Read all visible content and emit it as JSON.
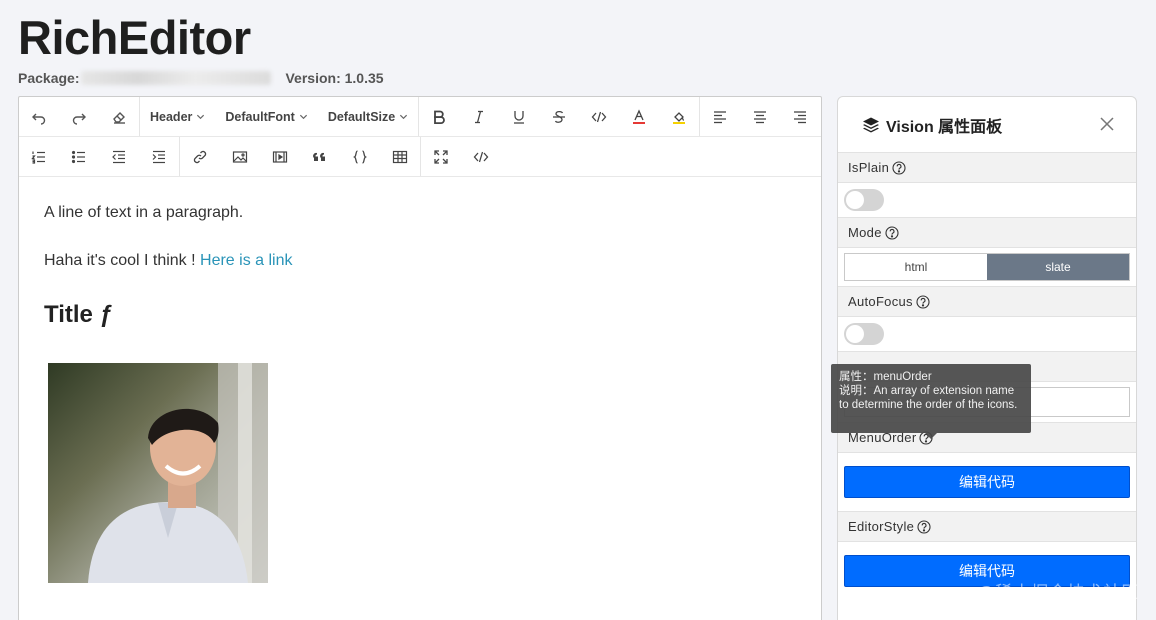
{
  "app": {
    "title": "RichEditor",
    "package_label": "Package:",
    "version_label": "Version: 1.0.35"
  },
  "toolbar": {
    "row1": {
      "history": [
        "undo-icon",
        "redo-icon",
        "eraser-icon"
      ],
      "header_select": "Header",
      "font_select": "DefaultFont",
      "size_select": "DefaultSize",
      "format": [
        "bold-icon",
        "italic-icon",
        "underline-icon",
        "strikethrough-icon",
        "code-icon",
        "font-color-icon",
        "highlight-icon"
      ],
      "align": [
        "align-left-icon",
        "align-center-icon",
        "align-right-icon"
      ]
    },
    "row2": {
      "lists": [
        "ordered-list-icon",
        "bulleted-list-icon",
        "outdent-icon",
        "indent-icon"
      ],
      "insert": [
        "link-icon",
        "image-icon",
        "video-icon",
        "quote-icon",
        "code-block-icon",
        "table-icon"
      ],
      "view": [
        "fullscreen-icon",
        "source-code-icon"
      ]
    }
  },
  "content": {
    "paragraph1": "A line of text in a paragraph.",
    "paragraph2_text": "Haha it's cool I think ! ",
    "paragraph2_link": "Here is a link",
    "heading": "Title ƒ"
  },
  "panel": {
    "title": "Vision 属性面板",
    "props": {
      "isplain": "IsPlain",
      "mode": "Mode",
      "mode_options": [
        "html",
        "slate"
      ],
      "mode_selected": "slate",
      "autofocus": "AutoFocus",
      "menuorder": "MenuOrder",
      "menuorder_button": "编辑代码",
      "editorstyle": "EditorStyle",
      "editorstyle_button": "编辑代码"
    }
  },
  "tooltip": {
    "line1": "属性：menuOrder",
    "line2": "说明：An array of extension name to determine the order of the icons."
  },
  "watermark": "@稀土掘金技术社区",
  "colors": {
    "primary": "#006cff",
    "segment_active": "#6b7888",
    "link": "#2a94b8"
  }
}
